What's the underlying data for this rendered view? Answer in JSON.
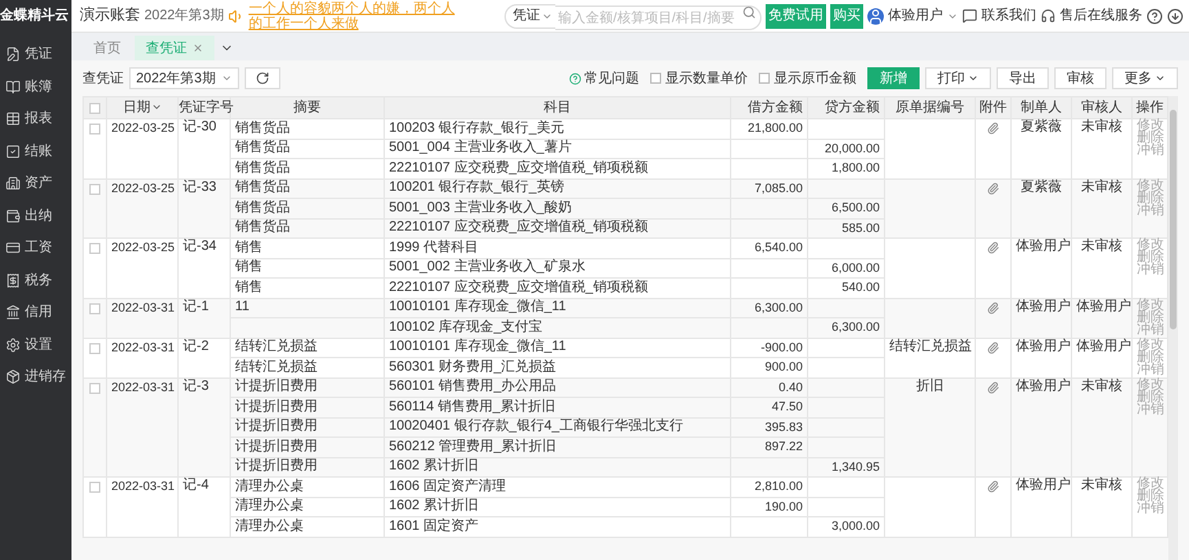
{
  "sidebar": {
    "logo": "金蝶精斗云",
    "items": [
      {
        "label": "凭证",
        "selected": false
      },
      {
        "label": "账簿",
        "selected": false
      },
      {
        "label": "报表",
        "selected": false
      },
      {
        "label": "结账",
        "selected": false
      },
      {
        "label": "资产",
        "selected": false
      },
      {
        "label": "出纳",
        "selected": false
      },
      {
        "label": "工资",
        "selected": false
      },
      {
        "label": "税务",
        "selected": false
      },
      {
        "label": "信用",
        "selected": false
      },
      {
        "label": "设置",
        "selected": false
      },
      {
        "label": "进销存",
        "selected": false
      }
    ]
  },
  "header": {
    "title": "演示账套",
    "period": "2022年第3期",
    "notice": "一个人的容貌两个人的嫌，两个人的工作一个人来做",
    "search_scope": "凭证",
    "search_placeholder": "输入金额/核算项目/科目/摘要",
    "trial_button": "免费试用",
    "buy_button": "购买",
    "user": "体验用户",
    "contact": "联系我们",
    "support": "售后在线服务"
  },
  "tabs": [
    {
      "label": "首页",
      "selected": false,
      "closable": false
    },
    {
      "label": "查凭证",
      "selected": true,
      "closable": true
    }
  ],
  "toolbar": {
    "label": "查凭证",
    "period": "2022年第3期",
    "faq": "常见问题",
    "options": [
      {
        "label": "显示数量单价",
        "checked": false
      },
      {
        "label": "显示原币金额",
        "checked": false
      }
    ],
    "buttons": [
      {
        "label": "新增",
        "kind": "primary"
      },
      {
        "label": "打印",
        "kind": "dropdown"
      },
      {
        "label": "导出",
        "kind": "plain"
      },
      {
        "label": "审核",
        "kind": "plain"
      },
      {
        "label": "更多",
        "kind": "dropdown"
      }
    ]
  },
  "table": {
    "all_selected": false,
    "columns": [
      "日期",
      "凭证字号",
      "摘要",
      "科目",
      "借方金额",
      "贷方金额",
      "原单据编号",
      "附件",
      "制单人",
      "审核人",
      "操作"
    ],
    "vouchers": [
      {
        "selected": false,
        "date": "2022-03-25",
        "number": "记-30",
        "maker": "夏紫薇",
        "reviewer": "未审核",
        "actions": [
          "修改",
          "删除",
          "冲销"
        ],
        "lines": [
          {
            "summary": "销售货品",
            "account": "100203 银行存款_银行_美元",
            "debit": "21,800.00"
          },
          {
            "summary": "销售货品",
            "account": "5001_004 主营业务收入_薯片",
            "credit": "20,000.00"
          },
          {
            "summary": "销售货品",
            "account": "22210107 应交税费_应交增值税_销项税额",
            "credit": "1,800.00"
          }
        ]
      },
      {
        "selected": false,
        "date": "2022-03-25",
        "number": "记-33",
        "maker": "夏紫薇",
        "reviewer": "未审核",
        "actions": [
          "修改",
          "删除",
          "冲销"
        ],
        "lines": [
          {
            "summary": "销售货品",
            "account": "100201 银行存款_银行_英镑",
            "debit": "7,085.00"
          },
          {
            "summary": "销售货品",
            "account": "5001_003 主营业务收入_酸奶",
            "credit": "6,500.00"
          },
          {
            "summary": "销售货品",
            "account": "22210107 应交税费_应交增值税_销项税额",
            "credit": "585.00"
          }
        ]
      },
      {
        "selected": false,
        "date": "2022-03-25",
        "number": "记-34",
        "maker": "体验用户",
        "reviewer": "未审核",
        "actions": [
          "修改",
          "删除",
          "冲销"
        ],
        "lines": [
          {
            "summary": "销售",
            "account": "1999 代替科目",
            "debit": "6,540.00"
          },
          {
            "summary": "销售",
            "account": "5001_002 主营业务收入_矿泉水",
            "credit": "6,000.00"
          },
          {
            "summary": "销售",
            "account": "22210107 应交税费_应交增值税_销项税额",
            "credit": "540.00"
          }
        ]
      },
      {
        "selected": false,
        "date": "2022-03-31",
        "number": "记-1",
        "maker": "体验用户",
        "reviewer": "体验用户",
        "actions": [
          "修改",
          "删除",
          "冲销"
        ],
        "lines": [
          {
            "summary": "11",
            "account": "10010101 库存现金_微信_11",
            "debit": "6,300.00"
          },
          {
            "account": "100102 库存现金_支付宝",
            "credit": "6,300.00"
          }
        ]
      },
      {
        "selected": false,
        "date": "2022-03-31",
        "number": "记-2",
        "source_doc": "结转汇兑损益",
        "maker": "体验用户",
        "reviewer": "体验用户",
        "actions": [
          "修改",
          "删除",
          "冲销"
        ],
        "lines": [
          {
            "summary": "结转汇兑损益",
            "account": "10010101 库存现金_微信_11",
            "debit": "-900.00"
          },
          {
            "summary": "结转汇兑损益",
            "account": "560301 财务费用_汇兑损益",
            "debit": "900.00"
          }
        ]
      },
      {
        "selected": false,
        "date": "2022-03-31",
        "number": "记-3",
        "source_doc": "折旧",
        "maker": "体验用户",
        "reviewer": "未审核",
        "actions": [
          "修改",
          "删除",
          "冲销"
        ],
        "lines": [
          {
            "summary": "计提折旧费用",
            "account": "560101 销售费用_办公用品",
            "debit": "0.40"
          },
          {
            "summary": "计提折旧费用",
            "account": "560114 销售费用_累计折旧",
            "debit": "47.50"
          },
          {
            "summary": "计提折旧费用",
            "account": "10020401 银行存款_银行4_工商银行华强北支行",
            "debit": "395.83"
          },
          {
            "summary": "计提折旧费用",
            "account": "560212 管理费用_累计折旧",
            "debit": "897.22"
          },
          {
            "summary": "计提折旧费用",
            "account": "1602 累计折旧",
            "credit": "1,340.95"
          }
        ]
      },
      {
        "selected": false,
        "date": "2022-03-31",
        "number": "记-4",
        "maker": "体验用户",
        "reviewer": "未审核",
        "actions": [
          "修改",
          "删除",
          "冲销"
        ],
        "lines": [
          {
            "summary": "清理办公桌",
            "account": "1606 固定资产清理",
            "debit": "2,810.00"
          },
          {
            "summary": "清理办公桌",
            "account": "1602 累计折旧",
            "debit": "190.00"
          },
          {
            "summary": "清理办公桌",
            "account": "1601 固定资产",
            "credit": "3,000.00"
          }
        ]
      }
    ]
  }
}
